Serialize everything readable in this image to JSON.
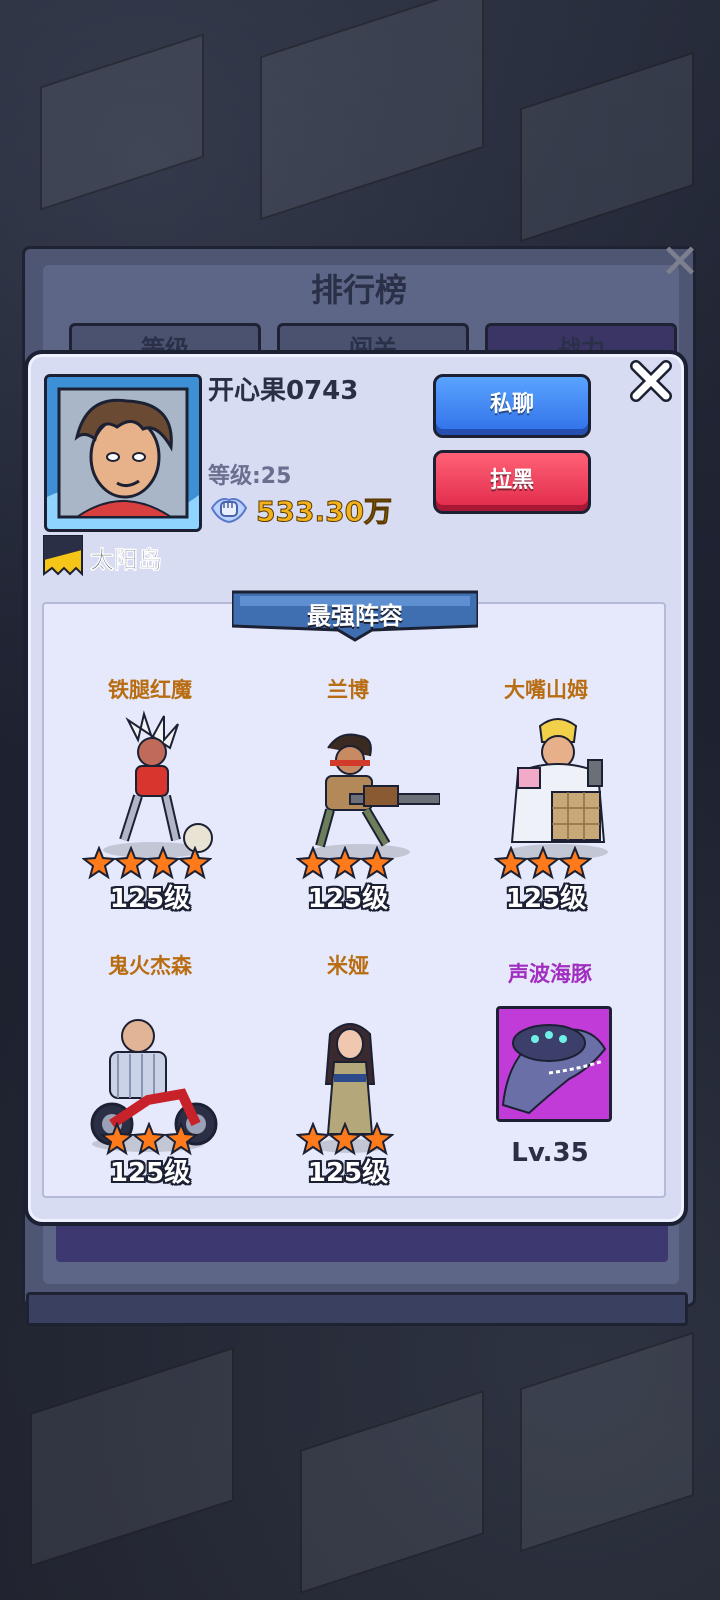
{
  "leaderboard": {
    "title": "排行榜",
    "tabs": [
      "等级",
      "闯关",
      "战力"
    ]
  },
  "player": {
    "name": "开心果0743",
    "level_text": "等级:25",
    "power": "533.30万",
    "guild": "太阳岛"
  },
  "actions": {
    "chat_label": "私聊",
    "block_label": "拉黑"
  },
  "lineup": {
    "title": "最强阵容",
    "heroes": [
      {
        "name": "铁腿红魔",
        "level": "125级",
        "stars": 4
      },
      {
        "name": "兰博",
        "level": "125级",
        "stars": 3
      },
      {
        "name": "大嘴山姆",
        "level": "125级",
        "stars": 3
      },
      {
        "name": "鬼火杰森",
        "level": "125级",
        "stars": 3
      },
      {
        "name": "米娅",
        "level": "125级",
        "stars": 3
      }
    ],
    "pet": {
      "name": "声波海豚",
      "level": "Lv.35"
    }
  },
  "colors": {
    "hero_name": "#b96d12",
    "pet_name": "#a12ec0",
    "power": "#f3b21b",
    "chat_button": "#3f86f2",
    "block_button": "#f03b58"
  },
  "icons": [
    "close-icon",
    "fist-power-icon",
    "guild-flag-icon",
    "star-icon"
  ]
}
